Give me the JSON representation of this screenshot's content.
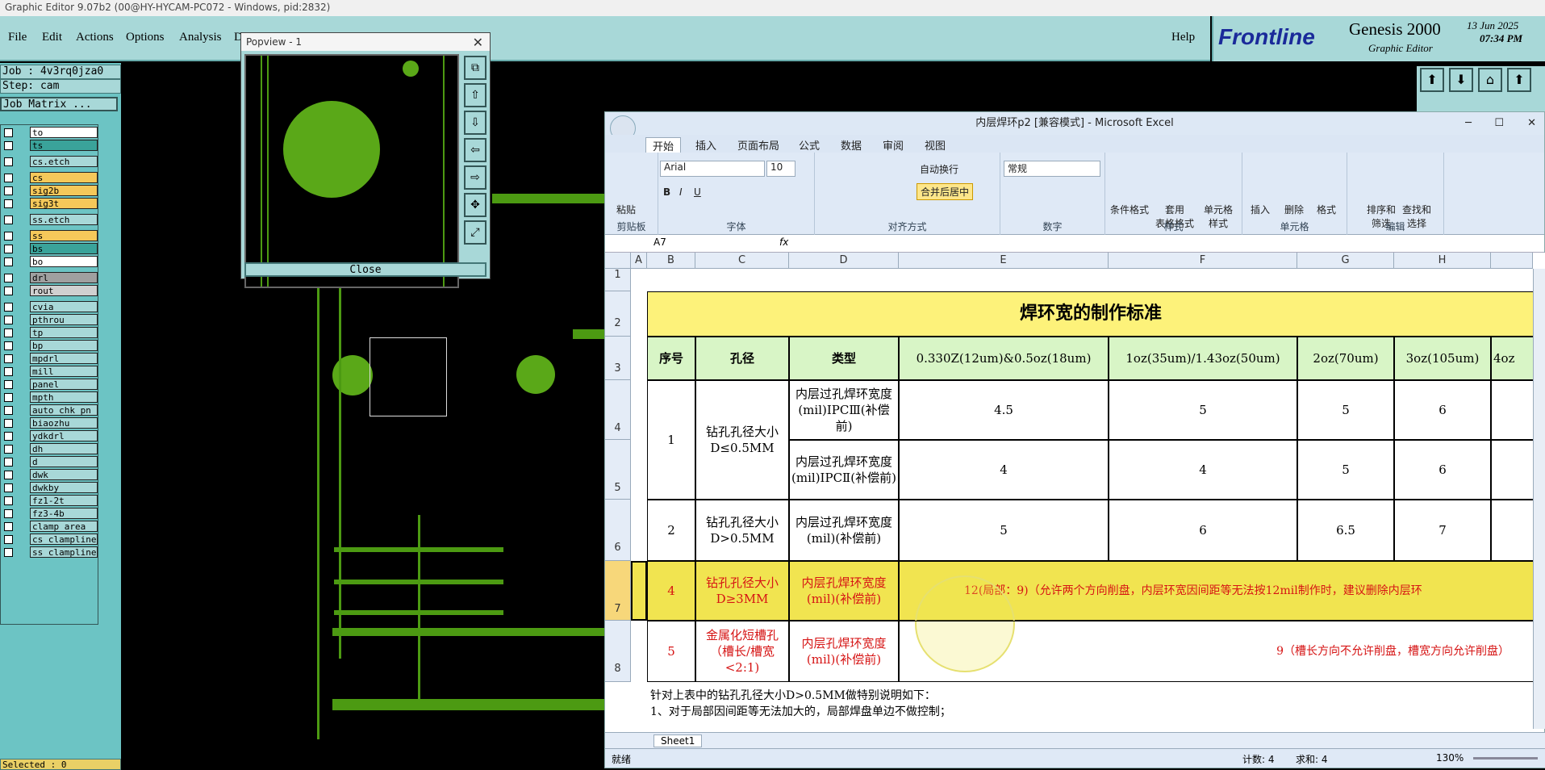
{
  "window_title": "Graphic Editor 9.07b2 (00@HY-HYCAM-PC072 - Windows, pid:2832)",
  "menu": [
    "File",
    "Edit",
    "Actions",
    "Options",
    "Analysis",
    "D"
  ],
  "help": "Help",
  "brand": {
    "frontline": "Frontline",
    "product": "Genesis 2000",
    "sub": "Graphic Editor",
    "date": "13 Jun 2025",
    "time": "07:34 PM"
  },
  "job": "Job : 4v3rq0jza0",
  "step": "Step: cam",
  "job_matrix": "Job Matrix ...",
  "layers": [
    "to",
    "ts",
    "cs.etch",
    "cs",
    "sig2b",
    "sig3t",
    "ss.etch",
    "ss",
    "bs",
    "bo",
    "drl",
    "rout",
    "cvia",
    "pthrou",
    "tp",
    "bp",
    "mpdrl",
    "mill",
    "panel",
    "mpth",
    "auto_chk_pn",
    "biaozhu",
    "ydkdrl",
    "dh",
    "d",
    "dwk",
    "dwkby",
    "fz1-2t",
    "fz3-4b",
    "clamp_area",
    "cs_clampline",
    "ss_clampline"
  ],
  "selected": "Selected : 0",
  "popview": {
    "title": "Popview - 1",
    "close": "Close"
  },
  "excel": {
    "title": "内层焊环p2  [兼容模式] - Microsoft Excel",
    "tabs": [
      "开始",
      "插入",
      "页面布局",
      "公式",
      "数据",
      "审阅",
      "视图"
    ],
    "font": "Arial",
    "size": "10",
    "numfmt": "常规",
    "wrap": "自动换行",
    "merge": "合并后居中",
    "groups": [
      "剪贴板",
      "字体",
      "对齐方式",
      "数字",
      "样式",
      "单元格",
      "编辑"
    ],
    "paste": "粘贴",
    "cond": "条件格式",
    "tablefmt": "套用\n表格格式",
    "cellstyle": "单元格\n样式",
    "insert": "插入",
    "delete": "删除",
    "format": "格式",
    "sort": "排序和\n筛选",
    "find": "查找和\n选择",
    "namebox": "A7",
    "fx": "fx",
    "cols": [
      "A",
      "B",
      "C",
      "D",
      "E",
      "F",
      "G",
      "H"
    ],
    "rows": [
      "1",
      "2",
      "3",
      "4",
      "5",
      "6",
      "7",
      "8"
    ],
    "table_title": "焊环宽的制作标准",
    "headers": [
      "序号",
      "孔径",
      "类型",
      "0.330Z(12um)&0.5oz(18um)",
      "1oz(35um)/1.43oz(50um)",
      "2oz(70um)",
      "3oz(105um)",
      "4oz"
    ],
    "r1": {
      "no": "1",
      "dia": "钻孔孔径大小D≤0.5MM",
      "t4": "内层过孔焊环宽度(mil)IPCⅢ(补偿前)",
      "v4": [
        "4.5",
        "5",
        "5",
        "6"
      ],
      "t5": "内层过孔焊环宽度(mil)IPCⅡ(补偿前)",
      "v5": [
        "4",
        "4",
        "5",
        "6"
      ]
    },
    "r2": {
      "no": "2",
      "dia": "钻孔孔径大小D>0.5MM",
      "type": "内层过孔焊环宽度(mil)(补偿前)",
      "v": [
        "5",
        "6",
        "6.5",
        "7"
      ]
    },
    "r7": {
      "no": "4",
      "dia": "钻孔孔径大小D≥3MM",
      "type": "内层孔焊环宽度(mil)(补偿前)",
      "val": "12(局部：9)（允许两个方向削盘，内层环宽因间距等无法按12mil制作时，建议删除内层环"
    },
    "r8": {
      "no": "5",
      "dia": "金属化短槽孔（槽长/槽宽<2:1)",
      "type": "内层孔焊环宽度(mil)(补偿前)",
      "val": "9（槽长方向不允许削盘，槽宽方向允许削盘）"
    },
    "note1": "针对上表中的钻孔孔径大小D>0.5MM做特别说明如下：",
    "note2": "1、对于局部因间距等无法加大的，局部焊盘单边不做控制；",
    "sheet": "Sheet1",
    "status": {
      "ready": "就绪",
      "count": "计数: 4",
      "sum": "求和: 4",
      "zoom": "130%"
    }
  }
}
